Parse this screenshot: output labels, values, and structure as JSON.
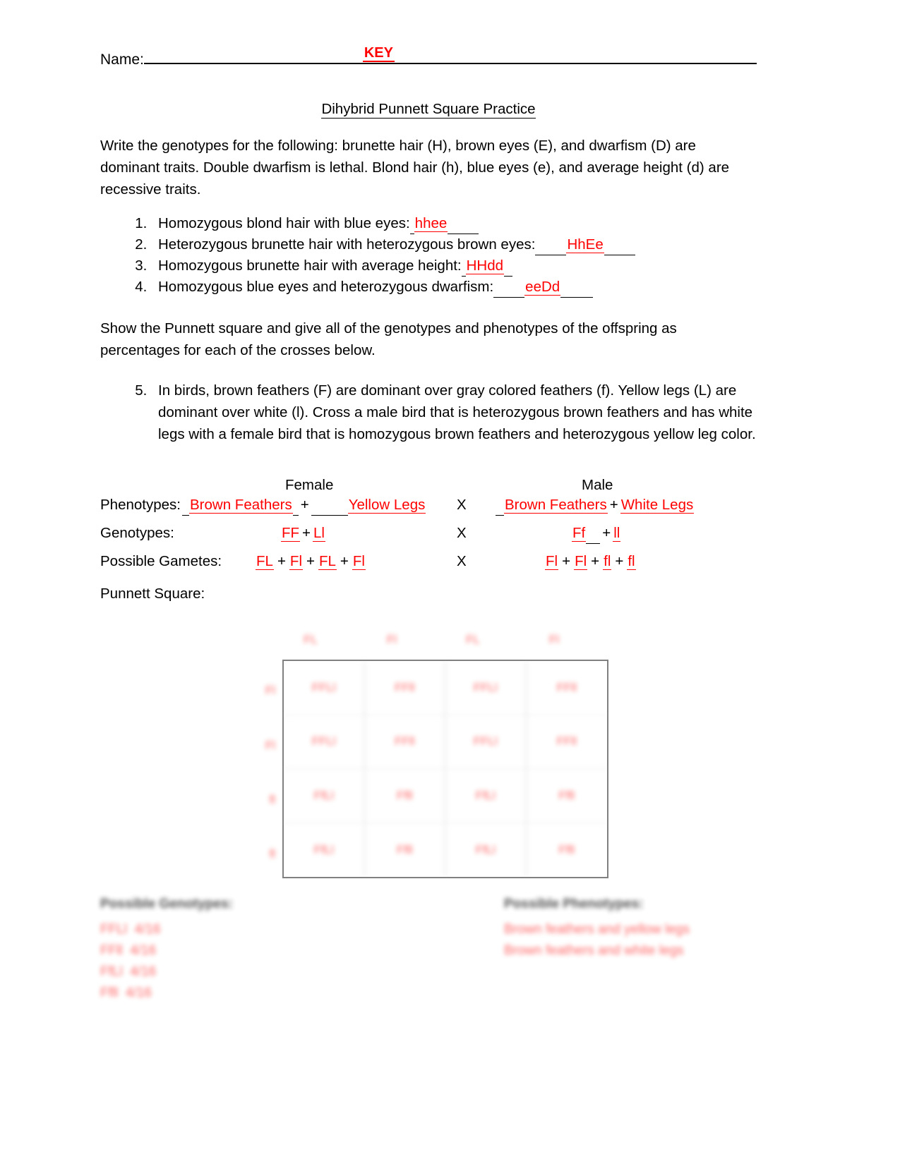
{
  "header": {
    "name_label": "Name:",
    "key_text": "KEY",
    "title": "Dihybrid Punnett Square Practice"
  },
  "intro": {
    "paragraph": "Write the genotypes for the following:  brunette hair (H), brown eyes (E), and dwarfism (D) are dominant traits. Double dwarfism is lethal.  Blond hair (h), blue eyes (e), and average height (d) are recessive traits.",
    "instruction": "Show the Punnett square and give all of the genotypes and phenotypes of the offspring as percentages for each of the crosses below."
  },
  "questions": [
    {
      "number": "1.",
      "text": "Homozygous blond hair with blue eyes:",
      "answer": "hhee"
    },
    {
      "number": "2.",
      "text": "Heterozygous brunette hair with heterozygous brown eyes:",
      "answer": "HhEe"
    },
    {
      "number": "3.",
      "text": "Homozygous brunette hair with average height:",
      "answer": "HHdd"
    },
    {
      "number": "4.",
      "text": "Homozygous blue eyes and heterozygous dwarfism:",
      "answer": "eeDd"
    }
  ],
  "question5": {
    "number": "5.",
    "text": "In birds, brown feathers (F) are dominant over gray colored feathers (f).  Yellow legs (L) are dominant over white (l).  Cross a male bird that is heterozygous brown feathers and has white legs with a female bird that is homozygous brown feathers and heterozygous yellow leg color."
  },
  "cross": {
    "female_header": "Female",
    "male_header": "Male",
    "x_symbol": "X",
    "plus": "+",
    "phenotypes": {
      "label": "Phenotypes:",
      "female_trait1": "Brown Feathers",
      "female_trait2": "Yellow Legs",
      "male_trait1": "Brown Feathers",
      "male_trait2": "White Legs"
    },
    "genotypes": {
      "label": "Genotypes:",
      "female_gene1": "FF",
      "female_gene2": "Ll",
      "male_gene1": "Ff",
      "male_gene2": "ll"
    },
    "gametes": {
      "label": "Possible Gametes:",
      "female": [
        "FL",
        "Fl",
        "FL",
        "Fl"
      ],
      "male": [
        "Fl",
        "Fl",
        "fl",
        "fl"
      ]
    },
    "punnett_label": "Punnett Square:"
  },
  "punnett": {
    "col_headers": [
      "FL",
      "Fl",
      "FL",
      "Fl"
    ],
    "row_headers": [
      "Fl",
      "Fl",
      "fl",
      "fl"
    ],
    "cells": [
      [
        "FFLl",
        "FFll",
        "FFLl",
        "FFll"
      ],
      [
        "FFLl",
        "FFll",
        "FFLl",
        "FFll"
      ],
      [
        "FfLl",
        "Ffll",
        "FfLl",
        "Ffll"
      ],
      [
        "FfLl",
        "Ffll",
        "FfLl",
        "Ffll"
      ]
    ]
  },
  "results": {
    "genotypes_heading": "Possible Genotypes:",
    "genotype_items": [
      "FFLl  4/16",
      "FFll  4/16",
      "FfLl  4/16",
      "Ffll  4/16"
    ],
    "phenotypes_heading": "Possible Phenotypes:",
    "phenotype_items": [
      "Brown feathers and yellow legs",
      "Brown feathers and white legs"
    ]
  },
  "colors": {
    "answer_red": "#ff0000",
    "text_black": "#000000",
    "grid_border": "#808080"
  }
}
